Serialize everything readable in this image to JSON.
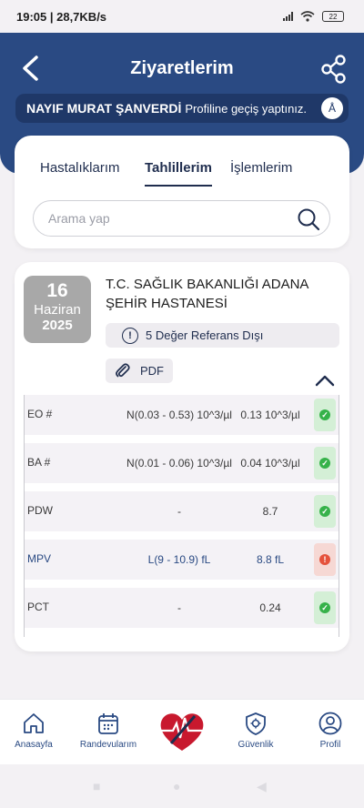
{
  "status_bar": {
    "time_speed": "19:05 | 28,7KB/s",
    "battery": "22"
  },
  "header": {
    "title": "Ziyaretlerim"
  },
  "profile_bar": {
    "name": "NAYIF MURAT ŞANVERDİ",
    "message": "Profiline geçiş yaptınız.",
    "badge": "Å"
  },
  "tabs": [
    {
      "label": "Hastalıklarım",
      "active": false
    },
    {
      "label": "Tahlillerim",
      "active": true
    },
    {
      "label": "İşlemlerim",
      "active": false
    }
  ],
  "search": {
    "placeholder": "Arama yap"
  },
  "visit": {
    "day": "16",
    "month": "Haziran",
    "year": "2025",
    "hospital": "T.C. SAĞLIK BAKANLIĞI ADANA ŞEHİR HASTANESİ",
    "warning": "5 Değer Referans Dışı",
    "warning_icon": "!",
    "pdf_label": "PDF"
  },
  "results": [
    {
      "name": "EO #",
      "ref": "N(0.03 - 0.53) 10^3/µl",
      "value": "0.13 10^3/µl",
      "status": "ok"
    },
    {
      "name": "BA #",
      "ref": "N(0.01 - 0.06) 10^3/µl",
      "value": "0.04 10^3/µl",
      "status": "ok"
    },
    {
      "name": "PDW",
      "ref": "-",
      "value": "8.7",
      "status": "ok"
    },
    {
      "name": "MPV",
      "ref": "L(9 - 10.9) fL",
      "value": "8.8 fL",
      "status": "bad"
    },
    {
      "name": "PCT",
      "ref": "-",
      "value": "0.24",
      "status": "ok"
    }
  ],
  "bottom_nav": [
    {
      "label": "Anasayfa",
      "icon": "home-icon"
    },
    {
      "label": "Randevularım",
      "icon": "calendar-icon"
    },
    {
      "label": "",
      "icon": "heart-logo-icon"
    },
    {
      "label": "Güvenlik",
      "icon": "shield-gear-icon"
    },
    {
      "label": "Profil",
      "icon": "profile-icon"
    }
  ],
  "colors": {
    "primary": "#2a4a83",
    "ok": "#36b24a",
    "bad": "#e5523c"
  }
}
